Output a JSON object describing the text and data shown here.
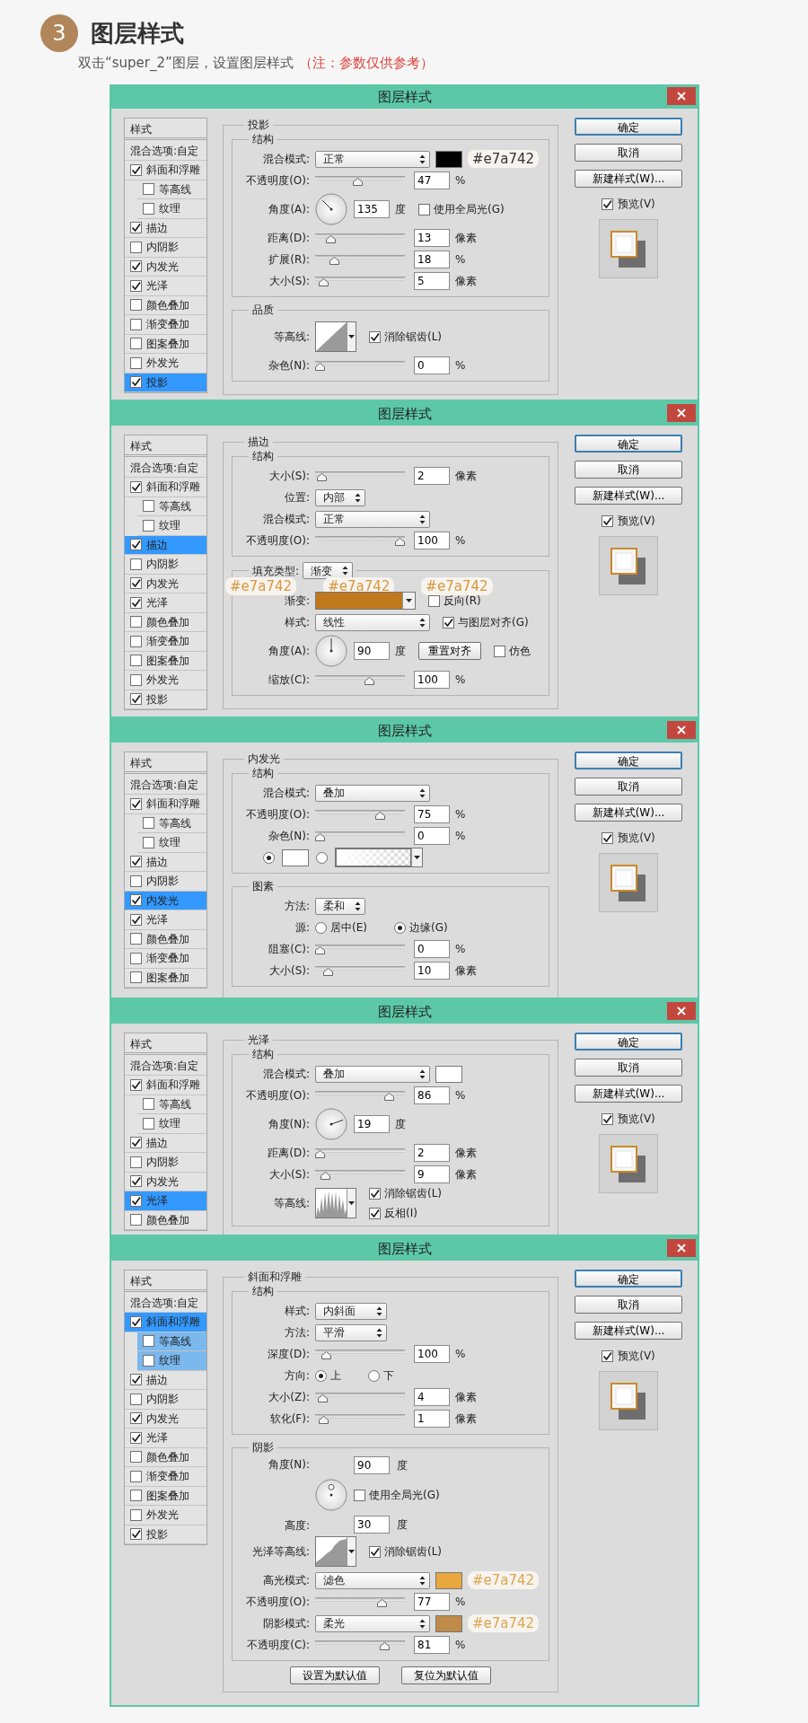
{
  "header": {
    "step": "3",
    "title": "图层样式",
    "instruction": "双击“super_2”图层，设置图层样式",
    "note": "（注：参数仅供参考）"
  },
  "dialogs": [
    {
      "title": "图层样式",
      "sidebar": {
        "header": "样式",
        "blend": "混合选项:自定",
        "items": [
          {
            "label": "斜面和浮雕",
            "checked": true,
            "selected": false,
            "children": [
              {
                "label": "等高线",
                "checked": false,
                "selected": false
              },
              {
                "label": "纹理",
                "checked": false,
                "selected": false
              }
            ]
          },
          {
            "label": "描边",
            "checked": true,
            "selected": false
          },
          {
            "label": "内阴影",
            "checked": false,
            "selected": false
          },
          {
            "label": "内发光",
            "checked": true,
            "selected": false
          },
          {
            "label": "光泽",
            "checked": true,
            "selected": false
          },
          {
            "label": "颜色叠加",
            "checked": false,
            "selected": false
          },
          {
            "label": "渐变叠加",
            "checked": false,
            "selected": false
          },
          {
            "label": "图案叠加",
            "checked": false,
            "selected": false
          },
          {
            "label": "外发光",
            "checked": false,
            "selected": false
          },
          {
            "label": "投影",
            "checked": true,
            "selected": true
          }
        ]
      },
      "panel": {
        "title": "投影",
        "groups": [
          {
            "title": "结构",
            "rows": [
              {
                "kind": "select",
                "label": "混合模式:",
                "value": "正常",
                "after": [
                  {
                    "kind": "swatch",
                    "color": "#000000"
                  },
                  {
                    "kind": "tag",
                    "text": "#e7a742",
                    "color": "#333333"
                  }
                ]
              },
              {
                "kind": "slider",
                "label": "不透明度(O):",
                "level": 0.47,
                "value": "47",
                "unit": "%"
              },
              {
                "kind": "angle",
                "label": "角度(A):",
                "value": "135",
                "unit": "度",
                "after": [
                  {
                    "kind": "checkbox",
                    "label": "使用全局光(G)",
                    "checked": false
                  }
                ]
              },
              {
                "kind": "slider",
                "label": "距离(D):",
                "level": 0.13,
                "value": "13",
                "unit": "像素"
              },
              {
                "kind": "slider",
                "label": "扩展(R):",
                "level": 0.18,
                "value": "18",
                "unit": "%"
              },
              {
                "kind": "slider",
                "label": "大小(S):",
                "level": 0.05,
                "value": "5",
                "unit": "像素"
              }
            ]
          },
          {
            "title": "品质",
            "rows": [
              {
                "kind": "contour",
                "label": "等高线:",
                "checkboxes": [
                  {
                    "label": "消除锯齿(L)",
                    "checked": true
                  }
                ]
              },
              {
                "kind": "slider",
                "label": "杂色(N):",
                "level": 0,
                "value": "0",
                "unit": "%"
              }
            ]
          }
        ]
      },
      "buttons": [
        {
          "label": "确定",
          "is_default": true
        },
        {
          "label": "取消",
          "is_default": false
        },
        {
          "label": "新建样式(W)...",
          "is_default": false
        }
      ],
      "preview": {
        "label": "预览(V)",
        "checked": true
      }
    },
    {
      "title": "图层样式",
      "sidebar": {
        "header": "样式",
        "blend": "混合选项:自定",
        "items": [
          {
            "label": "斜面和浮雕",
            "checked": true,
            "selected": false,
            "children": [
              {
                "label": "等高线",
                "checked": false,
                "selected": false
              },
              {
                "label": "纹理",
                "checked": false,
                "selected": false
              }
            ]
          },
          {
            "label": "描边",
            "checked": true,
            "selected": true
          },
          {
            "label": "内阴影",
            "checked": false,
            "selected": false
          },
          {
            "label": "内发光",
            "checked": true,
            "selected": false
          },
          {
            "label": "光泽",
            "checked": true,
            "selected": false
          },
          {
            "label": "颜色叠加",
            "checked": false,
            "selected": false
          },
          {
            "label": "渐变叠加",
            "checked": false,
            "selected": false
          },
          {
            "label": "图案叠加",
            "checked": false,
            "selected": false
          },
          {
            "label": "外发光",
            "checked": false,
            "selected": false
          },
          {
            "label": "投影",
            "checked": true,
            "selected": false
          }
        ]
      },
      "panel": {
        "title": "描边",
        "groups": [
          {
            "title": "结构",
            "rows": [
              {
                "kind": "slider",
                "label": "大小(S):",
                "level": 0.02,
                "value": "2",
                "unit": "像素"
              },
              {
                "kind": "short-select",
                "label": "位置:",
                "value": "内部"
              },
              {
                "kind": "select",
                "label": "混合模式:",
                "value": "正常"
              },
              {
                "kind": "slider",
                "label": "不透明度(O):",
                "level": 1,
                "value": "100",
                "unit": "%"
              }
            ]
          },
          {
            "legend_row": {
              "kind": "short-select",
              "label": "填充类型:",
              "value": "渐变"
            },
            "rows": [
              {
                "kind": "tags",
                "items": [
                  {
                    "text": "#e7a742",
                    "color": "#d9963a"
                  },
                  {
                    "text": "#e7a742",
                    "color": "#d9963a"
                  },
                  {
                    "text": "#e7a742",
                    "color": "#d9963a"
                  }
                ]
              },
              {
                "kind": "gradient",
                "label": "渐变:",
                "color": "#bf781c",
                "after": [
                  {
                    "kind": "checkbox",
                    "label": "反向(R)",
                    "checked": false
                  }
                ]
              },
              {
                "kind": "select",
                "label": "样式:",
                "value": "线性",
                "after": [
                  {
                    "kind": "checkbox",
                    "label": "与图层对齐(G)",
                    "checked": true
                  }
                ]
              },
              {
                "kind": "angle",
                "label": "角度(A):",
                "value": "90",
                "unit": "度",
                "after": [
                  {
                    "kind": "button",
                    "label": "重置对齐"
                  },
                  {
                    "kind": "checkbox",
                    "label": "仿色",
                    "checked": false
                  }
                ]
              },
              {
                "kind": "slider",
                "label": "缩放(C):",
                "level": 0.62,
                "value": "100",
                "unit": "%"
              }
            ]
          }
        ]
      },
      "buttons": [
        {
          "label": "确定",
          "is_default": true
        },
        {
          "label": "取消",
          "is_default": false
        },
        {
          "label": "新建样式(W)...",
          "is_default": false
        }
      ],
      "preview": {
        "label": "预览(V)",
        "checked": true
      }
    },
    {
      "title": "图层样式",
      "sidebar": {
        "header": "样式",
        "blend": "混合选项:自定",
        "items": [
          {
            "label": "斜面和浮雕",
            "checked": true,
            "selected": false,
            "children": [
              {
                "label": "等高线",
                "checked": false,
                "selected": false
              },
              {
                "label": "纹理",
                "checked": false,
                "selected": false
              }
            ]
          },
          {
            "label": "描边",
            "checked": true,
            "selected": false
          },
          {
            "label": "内阴影",
            "checked": false,
            "selected": false
          },
          {
            "label": "内发光",
            "checked": true,
            "selected": true
          },
          {
            "label": "光泽",
            "checked": true,
            "selected": false
          },
          {
            "label": "颜色叠加",
            "checked": false,
            "selected": false
          },
          {
            "label": "渐变叠加",
            "checked": false,
            "selected": false
          },
          {
            "label": "图案叠加",
            "checked": false,
            "selected": false
          }
        ]
      },
      "panel": {
        "title": "内发光",
        "groups": [
          {
            "title": "结构",
            "rows": [
              {
                "kind": "select",
                "label": "混合模式:",
                "value": "叠加"
              },
              {
                "kind": "slider",
                "label": "不透明度(O):",
                "level": 0.75,
                "value": "75",
                "unit": "%"
              },
              {
                "kind": "slider",
                "label": "杂色(N):",
                "level": 0,
                "value": "0",
                "unit": "%"
              },
              {
                "kind": "glow-source",
                "options": [
                  {
                    "selected": true,
                    "color": "#ffffff"
                  },
                  {
                    "selected": false
                  }
                ]
              }
            ]
          },
          {
            "title": "图素",
            "rows": [
              {
                "kind": "short-select",
                "label": "方法:",
                "value": "柔和"
              },
              {
                "kind": "radio",
                "label": "源:",
                "options": [
                  {
                    "label": "居中(E)",
                    "selected": false
                  },
                  {
                    "label": "边缘(G)",
                    "selected": true
                  }
                ]
              },
              {
                "kind": "slider",
                "label": "阻塞(C):",
                "level": 0,
                "value": "0",
                "unit": "%"
              },
              {
                "kind": "slider",
                "label": "大小(S):",
                "level": 0.1,
                "value": "10",
                "unit": "像素"
              }
            ]
          }
        ]
      },
      "buttons": [
        {
          "label": "确定",
          "is_default": true
        },
        {
          "label": "取消",
          "is_default": false
        },
        {
          "label": "新建样式(W)...",
          "is_default": false
        }
      ],
      "preview": {
        "label": "预览(V)",
        "checked": true
      }
    },
    {
      "title": "图层样式",
      "sidebar": {
        "header": "样式",
        "blend": "混合选项:自定",
        "items": [
          {
            "label": "斜面和浮雕",
            "checked": true,
            "selected": false,
            "children": [
              {
                "label": "等高线",
                "checked": false,
                "selected": false
              },
              {
                "label": "纹理",
                "checked": false,
                "selected": false
              }
            ]
          },
          {
            "label": "描边",
            "checked": true,
            "selected": false
          },
          {
            "label": "内阴影",
            "checked": false,
            "selected": false
          },
          {
            "label": "内发光",
            "checked": true,
            "selected": false
          },
          {
            "label": "光泽",
            "checked": true,
            "selected": true
          },
          {
            "label": "颜色叠加",
            "checked": false,
            "selected": false
          }
        ]
      },
      "panel": {
        "title": "光泽",
        "groups": [
          {
            "title": "结构",
            "rows": [
              {
                "kind": "select",
                "label": "混合模式:",
                "value": "叠加",
                "after": [
                  {
                    "kind": "swatch",
                    "color": "#ffffff"
                  }
                ]
              },
              {
                "kind": "slider",
                "label": "不透明度(O):",
                "level": 0.86,
                "value": "86",
                "unit": "%"
              },
              {
                "kind": "angle",
                "label": "角度(N):",
                "value": "19",
                "unit": "度"
              },
              {
                "kind": "slider",
                "label": "距离(D):",
                "level": 0,
                "value": "2",
                "unit": "像素"
              },
              {
                "kind": "slider",
                "label": "大小(S):",
                "level": 0.07,
                "value": "9",
                "unit": "像素"
              },
              {
                "kind": "contour",
                "label": "等高线:",
                "checkboxes": [
                  {
                    "label": "消除锯齿(L)",
                    "checked": true
                  },
                  {
                    "label": "反相(I)",
                    "checked": true
                  }
                ]
              }
            ]
          }
        ]
      },
      "buttons": [
        {
          "label": "确定",
          "is_default": true
        },
        {
          "label": "取消",
          "is_default": false
        },
        {
          "label": "新建样式(W)...",
          "is_default": false
        }
      ],
      "preview": {
        "label": "预览(V)",
        "checked": true
      }
    },
    {
      "title": "图层样式",
      "sidebar": {
        "header": "样式",
        "blend": "混合选项:自定",
        "items": [
          {
            "label": "斜面和浮雕",
            "checked": true,
            "selected": true,
            "children": [
              {
                "label": "等高线",
                "checked": false,
                "selected": true
              },
              {
                "label": "纹理",
                "checked": false,
                "selected": true
              }
            ]
          },
          {
            "label": "描边",
            "checked": true,
            "selected": false
          },
          {
            "label": "内阴影",
            "checked": false,
            "selected": false
          },
          {
            "label": "内发光",
            "checked": true,
            "selected": false
          },
          {
            "label": "光泽",
            "checked": true,
            "selected": false
          },
          {
            "label": "颜色叠加",
            "checked": false,
            "selected": false
          },
          {
            "label": "渐变叠加",
            "checked": false,
            "selected": false
          },
          {
            "label": "图案叠加",
            "checked": false,
            "selected": false
          },
          {
            "label": "外发光",
            "checked": false,
            "selected": false
          },
          {
            "label": "投影",
            "checked": true,
            "selected": false
          }
        ]
      },
      "panel": {
        "title": "斜面和浮雕",
        "groups": [
          {
            "title": "结构",
            "rows": [
              {
                "kind": "medium-select",
                "label": "样式:",
                "value": "内斜面"
              },
              {
                "kind": "medium-select",
                "label": "方法:",
                "value": "平滑"
              },
              {
                "kind": "slider",
                "label": "深度(D):",
                "level": 0.08,
                "value": "100",
                "unit": "%"
              },
              {
                "kind": "radio",
                "label": "方向:",
                "options": [
                  {
                    "label": "上",
                    "selected": true
                  },
                  {
                    "label": "下",
                    "selected": false
                  }
                ]
              },
              {
                "kind": "slider",
                "label": "大小(Z):",
                "level": 0.03,
                "value": "4",
                "unit": "像素"
              },
              {
                "kind": "slider",
                "label": "软化(F):",
                "level": 0.05,
                "value": "1",
                "unit": "像素"
              }
            ]
          },
          {
            "title": "阴影",
            "rows": [
              {
                "kind": "shading",
                "label": "角度(N):",
                "value": "90",
                "unit": "度",
                "checkbox": {
                  "label": "使用全局光(G)",
                  "checked": false
                },
                "altitude_label": "高度:",
                "altitude_value": "30",
                "altitude_unit": "度"
              },
              {
                "kind": "contour",
                "label": "光泽等高线:",
                "checkboxes": [
                  {
                    "label": "消除锯齿(L)",
                    "checked": true
                  }
                ]
              },
              {
                "kind": "select",
                "label": "高光模式:",
                "value": "滤色",
                "after": [
                  {
                    "kind": "swatch",
                    "color": "#e8a83e"
                  },
                  {
                    "kind": "tag",
                    "text": "#e7a742",
                    "color": "#dca550"
                  }
                ]
              },
              {
                "kind": "slider",
                "label": "不透明度(O):",
                "level": 0.77,
                "value": "77",
                "unit": "%"
              },
              {
                "kind": "select",
                "label": "阴影模式:",
                "value": "柔光",
                "after": [
                  {
                    "kind": "swatch",
                    "color": "#c08a48"
                  },
                  {
                    "kind": "tag",
                    "text": "#e7a742",
                    "color": "#dca550"
                  }
                ]
              },
              {
                "kind": "slider",
                "label": "不透明度(C):",
                "level": 0.81,
                "value": "81",
                "unit": "%"
              }
            ]
          }
        ],
        "footer_buttons": [
          "设置为默认值",
          "复位为默认值"
        ]
      },
      "buttons": [
        {
          "label": "确定",
          "is_default": true
        },
        {
          "label": "取消",
          "is_default": false
        },
        {
          "label": "新建样式(W)...",
          "is_default": false
        }
      ],
      "preview": {
        "label": "预览(V)",
        "checked": true
      }
    }
  ]
}
